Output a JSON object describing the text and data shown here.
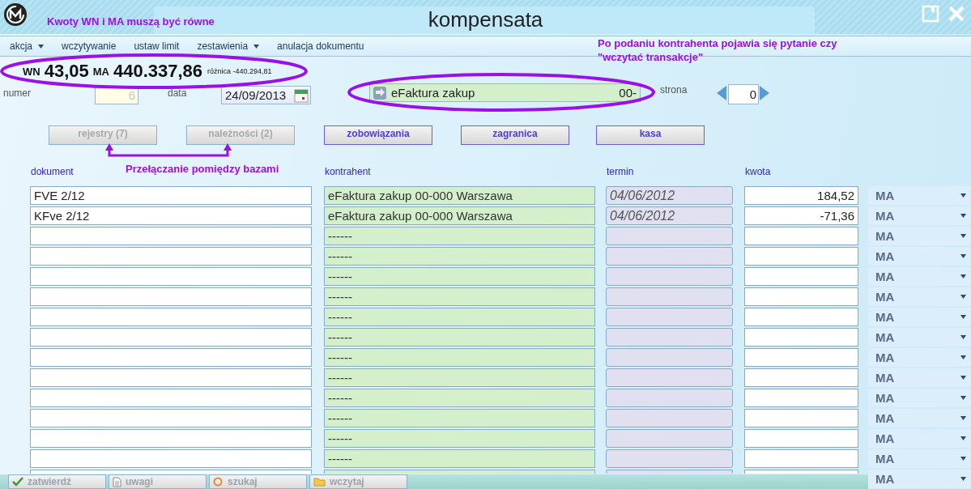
{
  "window": {
    "title": "kompensata"
  },
  "annotations": [
    {
      "kind": "note",
      "text": "Kwoty WN i MA muszą być równe"
    },
    {
      "kind": "note",
      "text": "Po podaniu kontrahenta pojawia się pytanie czy \"wczytać transakcje\""
    },
    {
      "kind": "note",
      "text": "Przełączanie pomiędzy bazami"
    }
  ],
  "menu": [
    {
      "label": "akcja",
      "has_menu": true
    },
    {
      "label": "wczytywanie",
      "has_menu": false
    },
    {
      "label": "ustaw limit",
      "has_menu": false
    },
    {
      "label": "zestawienia",
      "has_menu": true
    },
    {
      "label": "anulacja dokumentu",
      "has_menu": false
    }
  ],
  "totals": {
    "wn_label": "WN",
    "wn_value": "43,05",
    "ma_label": "MA",
    "ma_value": "440.337,86",
    "difference": "różnica -440.294,81"
  },
  "form": {
    "number": {
      "label": "numer",
      "value": "6",
      "disabled": true
    },
    "date": {
      "label": "data",
      "value": "24/09/2013"
    },
    "contractor": {
      "name": "eFaktura zakup",
      "code": "00-"
    },
    "page": {
      "label": "strona",
      "value": "0"
    }
  },
  "sources": [
    {
      "label": "rejestry   (7)",
      "disabled": true
    },
    {
      "label": "należności  (2)",
      "disabled": true
    },
    {
      "label": "zobowiązania",
      "disabled": false
    },
    {
      "label": "zagranica",
      "disabled": false
    },
    {
      "label": "kasa",
      "disabled": false
    }
  ],
  "columns": [
    "dokument",
    "kontrahent",
    "termin",
    "kwota"
  ],
  "rows": [
    {
      "document": "FVE   2/12",
      "contractor": "eFaktura zakup 00-000 Warszawa",
      "due": "04/06/2012",
      "amount": "184,52",
      "side": "MA"
    },
    {
      "document": "KFve  2/12",
      "contractor": "eFaktura zakup 00-000 Warszawa",
      "due": "04/06/2012",
      "amount": "-71,36",
      "side": "MA"
    },
    {
      "contractor": "------",
      "side": "MA"
    },
    {
      "contractor": "------",
      "side": "MA"
    },
    {
      "contractor": "------",
      "side": "MA"
    },
    {
      "contractor": "------",
      "side": "MA"
    },
    {
      "contractor": "------",
      "side": "MA"
    },
    {
      "contractor": "------",
      "side": "MA"
    },
    {
      "contractor": "------",
      "side": "MA"
    },
    {
      "contractor": "------",
      "side": "MA"
    },
    {
      "contractor": "------",
      "side": "MA"
    },
    {
      "contractor": "------",
      "side": "MA"
    },
    {
      "contractor": "------",
      "side": "MA"
    },
    {
      "contractor": "------",
      "side": "MA"
    },
    {
      "side": "MA"
    }
  ],
  "toolbar": [
    {
      "label": "zatwierdź"
    },
    {
      "label": "uwagi"
    },
    {
      "label": "szukaj"
    },
    {
      "label": "wczytaj"
    }
  ]
}
